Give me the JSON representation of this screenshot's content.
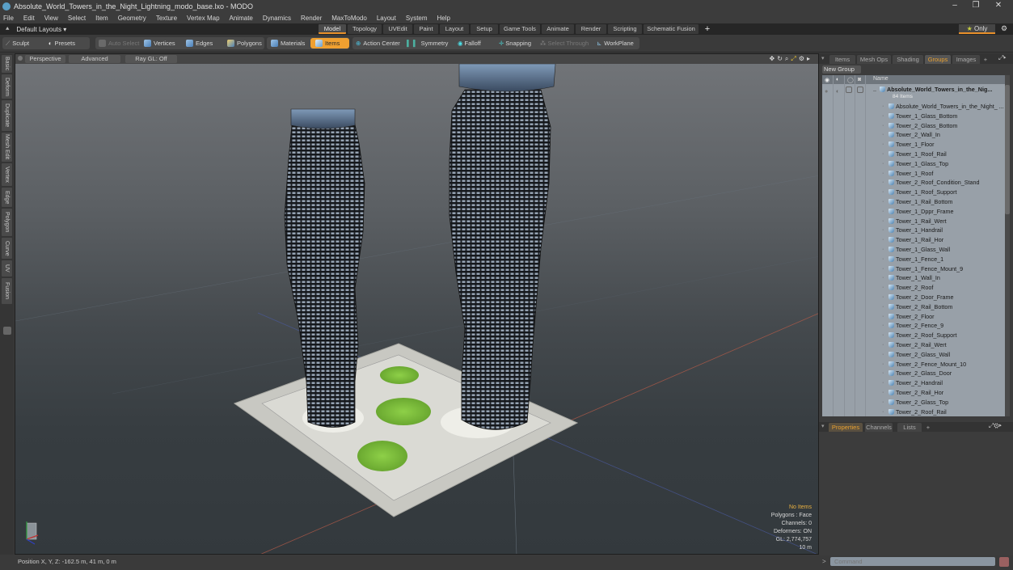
{
  "window": {
    "title": "Absolute_World_Towers_in_the_Night_Lightning_modo_base.lxo - MODO",
    "controls": [
      "minimize",
      "restore",
      "close"
    ]
  },
  "menu": [
    "File",
    "Edit",
    "View",
    "Select",
    "Item",
    "Geometry",
    "Texture",
    "Vertex Map",
    "Animate",
    "Dynamics",
    "Render",
    "MaxToModo",
    "Layout",
    "System",
    "Help"
  ],
  "layouts": {
    "current": "Default Layouts ▾",
    "tabs": [
      "Model",
      "Topology",
      "UVEdit",
      "Paint",
      "Layout",
      "Setup",
      "Game Tools",
      "Animate",
      "Render",
      "Scripting",
      "Schematic Fusion",
      "+"
    ],
    "active_tab": "Model",
    "only_label": "Only"
  },
  "toolbar": {
    "sculpt": "Sculpt",
    "presets": "Presets",
    "auto_select": "Auto Select",
    "vertices": "Vertices",
    "edges": "Edges",
    "polygons": "Polygons",
    "materials": "Materials",
    "items": "Items",
    "action_center": "Action Center",
    "symmetry": "Symmetry",
    "falloff": "Falloff",
    "snapping": "Snapping",
    "select_through": "Select Through",
    "workplane": "WorkPlane"
  },
  "left_tabs": [
    "Basic",
    "Deform",
    "Duplicate",
    "Mesh Edit",
    "Vertex",
    "Edge",
    "Polygon",
    "Curve",
    "UV",
    "Fusion"
  ],
  "viewport": {
    "view_mode": "Perspective",
    "shading": "Advanced",
    "raygl": "Ray GL: Off",
    "hud": {
      "selection": "No Items",
      "polygons": "Polygons : Face",
      "channels": "Channels: 0",
      "deformers": "Deformers: ON",
      "gl": "GL: 2,774,757",
      "scale": "10 m"
    }
  },
  "statusbar": {
    "position": "Position X, Y, Z:  -162.5 m, 41 m, 0 m"
  },
  "right_panel": {
    "tabs": [
      "Items",
      "Mesh Ops",
      "Shading",
      "Groups",
      "Images",
      "+"
    ],
    "active_tab": "Groups",
    "new_group": "New Group",
    "column_name": "Name",
    "group_name": "Absolute_World_Towers_in_the_Nig...",
    "group_count": "84 Items",
    "items": [
      "Absolute_World_Towers_in_the_Night_ ...",
      "Tower_1_Glass_Bottom",
      "Tower_2_Glass_Bottom",
      "Tower_2_Wall_In",
      "Tower_1_Floor",
      "Tower_1_Roof_Rail",
      "Tower_1_Glass_Top",
      "Tower_1_Roof",
      "Tower_2_Roof_Condition_Stand",
      "Tower_1_Roof_Support",
      "Tower_1_Rail_Bottom",
      "Tower_1_Dppr_Frame",
      "Tower_1_Rail_Wert",
      "Tower_1_Handrail",
      "Tower_1_Rail_Hor",
      "Tower_1_Glass_Wall",
      "Tower_1_Fence_1",
      "Tower_1_Fence_Mount_9",
      "Tower_1_Wall_In",
      "Tower_2_Roof",
      "Tower_2_Door_Frame",
      "Tower_2_Rail_Bottom",
      "Tower_2_Floor",
      "Tower_2_Fence_9",
      "Tower_2_Roof_Support",
      "Tower_2_Rail_Wert",
      "Tower_2_Glass_Wall",
      "Tower_2_Fence_Mount_10",
      "Tower_2_Glass_Door",
      "Tower_2_Handrail",
      "Tower_2_Rail_Hor",
      "Tower_2_Glass_Top",
      "Tower_2_Roof_Rail"
    ]
  },
  "properties_panel": {
    "tabs": [
      "Properties",
      "Channels",
      "Lists",
      "+"
    ],
    "active_tab": "Properties"
  },
  "command": {
    "placeholder": "Command"
  },
  "colors": {
    "accent": "#e8902a",
    "hud_highlight": "#e8b040",
    "list_bg": "#98a0a8"
  }
}
